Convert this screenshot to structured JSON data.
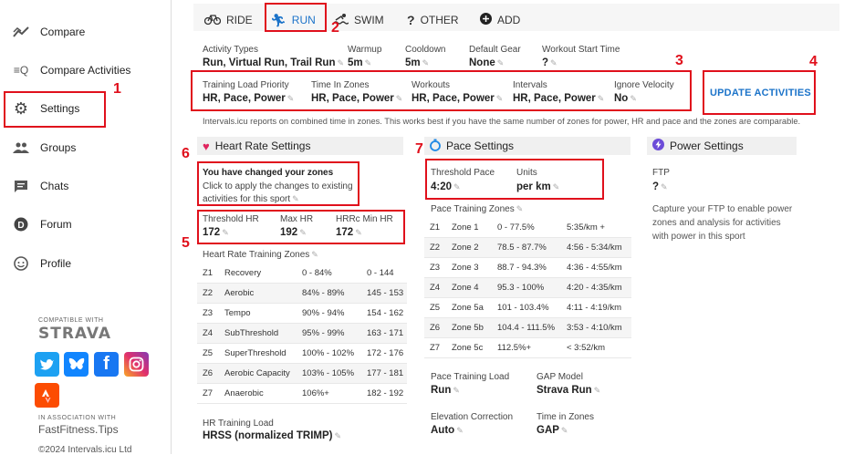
{
  "sidebar": {
    "items": [
      {
        "label": "Compare",
        "icon": "compare-icon"
      },
      {
        "label": "Compare Activities",
        "icon": "compare-activities-icon"
      },
      {
        "label": "Settings",
        "icon": "gear-icon"
      },
      {
        "label": "Groups",
        "icon": "groups-icon"
      },
      {
        "label": "Chats",
        "icon": "chat-icon"
      },
      {
        "label": "Forum",
        "icon": "forum-icon"
      },
      {
        "label": "Profile",
        "icon": "profile-icon"
      }
    ],
    "compatible_with": "COMPATIBLE WITH",
    "strava": "STRAVA",
    "association": "IN ASSOCIATION WITH",
    "fastfitness": "FastFitness.Tips",
    "copyright": "©2024 Intervals.icu Ltd"
  },
  "tabs": [
    {
      "label": "RIDE",
      "icon": "bike-icon"
    },
    {
      "label": "RUN",
      "icon": "run-icon"
    },
    {
      "label": "SWIM",
      "icon": "swim-icon"
    },
    {
      "label": "OTHER",
      "icon": "question-icon"
    },
    {
      "label": "ADD",
      "icon": "add-icon"
    }
  ],
  "general": {
    "activity_types_label": "Activity Types",
    "activity_types_value": "Run, Virtual Run, Trail Run",
    "warmup_label": "Warmup",
    "warmup_value": "5m",
    "cooldown_label": "Cooldown",
    "cooldown_value": "5m",
    "default_gear_label": "Default Gear",
    "default_gear_value": "None",
    "workout_start_label": "Workout Start Time",
    "workout_start_value": "?",
    "tlp_label": "Training Load Priority",
    "tlp_value": "HR, Pace, Power",
    "tiz_label": "Time In Zones",
    "tiz_value": "HR, Pace, Power",
    "workouts_label": "Workouts",
    "workouts_value": "HR, Pace, Power",
    "intervals_label": "Intervals",
    "intervals_value": "HR, Pace, Power",
    "ignore_velocity_label": "Ignore Velocity",
    "ignore_velocity_value": "No",
    "update_button": "UPDATE ACTIVITIES",
    "note": "Intervals.icu reports on combined time in zones. This works best if you have the same number of zones for power, HR and pace and the zones are comparable."
  },
  "hr": {
    "title": "Heart Rate Settings",
    "changed_title": "You have changed your zones",
    "changed_text_1": "Click to apply the changes to existing",
    "changed_text_2": "activities for this sport",
    "threshold_label": "Threshold HR",
    "threshold_value": "172",
    "max_label": "Max HR",
    "max_value": "192",
    "hrrc_label": "HRRc Min HR",
    "hrrc_value": "172",
    "zones_title": "Heart Rate Training Zones",
    "zones": [
      {
        "id": "Z1",
        "name": "Recovery",
        "pct": "0 - 84%",
        "bpm": "0 - 144"
      },
      {
        "id": "Z2",
        "name": "Aerobic",
        "pct": "84% - 89%",
        "bpm": "145 - 153"
      },
      {
        "id": "Z3",
        "name": "Tempo",
        "pct": "90% - 94%",
        "bpm": "154 - 162"
      },
      {
        "id": "Z4",
        "name": "SubThreshold",
        "pct": "95% - 99%",
        "bpm": "163 - 171"
      },
      {
        "id": "Z5",
        "name": "SuperThreshold",
        "pct": "100% - 102%",
        "bpm": "172 - 176"
      },
      {
        "id": "Z6",
        "name": "Aerobic Capacity",
        "pct": "103% - 105%",
        "bpm": "177 - 181"
      },
      {
        "id": "Z7",
        "name": "Anaerobic",
        "pct": "106%+",
        "bpm": "182 - 192"
      }
    ],
    "load_label": "HR Training Load",
    "load_value": "HRSS (normalized TRIMP)"
  },
  "pace": {
    "title": "Pace Settings",
    "threshold_label": "Threshold Pace",
    "threshold_value": "4:20",
    "units_label": "Units",
    "units_value": "per km",
    "zones_title": "Pace Training Zones",
    "zones": [
      {
        "id": "Z1",
        "name": "Zone 1",
        "pct": "0 - 77.5%",
        "pace": "5:35/km +"
      },
      {
        "id": "Z2",
        "name": "Zone 2",
        "pct": "78.5 - 87.7%",
        "pace": "4:56 - 5:34/km"
      },
      {
        "id": "Z3",
        "name": "Zone 3",
        "pct": "88.7 - 94.3%",
        "pace": "4:36 - 4:55/km"
      },
      {
        "id": "Z4",
        "name": "Zone 4",
        "pct": "95.3 - 100%",
        "pace": "4:20 - 4:35/km"
      },
      {
        "id": "Z5",
        "name": "Zone 5a",
        "pct": "101 - 103.4%",
        "pace": "4:11 - 4:19/km"
      },
      {
        "id": "Z6",
        "name": "Zone 5b",
        "pct": "104.4 - 111.5%",
        "pace": "3:53 - 4:10/km"
      },
      {
        "id": "Z7",
        "name": "Zone 5c",
        "pct": "112.5%+",
        "pace": "< 3:52/km"
      }
    ],
    "load_label": "Pace Training Load",
    "load_value": "Run",
    "gap_label": "GAP Model",
    "gap_value": "Strava Run",
    "elev_label": "Elevation Correction",
    "elev_value": "Auto",
    "tiz_label": "Time in Zones",
    "tiz_value": "GAP"
  },
  "power": {
    "title": "Power Settings",
    "ftp_label": "FTP",
    "ftp_value": "?",
    "capture_1": "Capture your FTP to enable power",
    "capture_2": "zones and analysis for activities",
    "capture_3": "with power in this sport"
  },
  "annotations": [
    "1",
    "2",
    "3",
    "4",
    "5",
    "6",
    "7"
  ],
  "colors": {
    "accent": "#1b73c9",
    "annotation": "#e0101c",
    "heart": "#e0245e",
    "pace": "#1e88e5",
    "power": "#6c4bd8"
  }
}
